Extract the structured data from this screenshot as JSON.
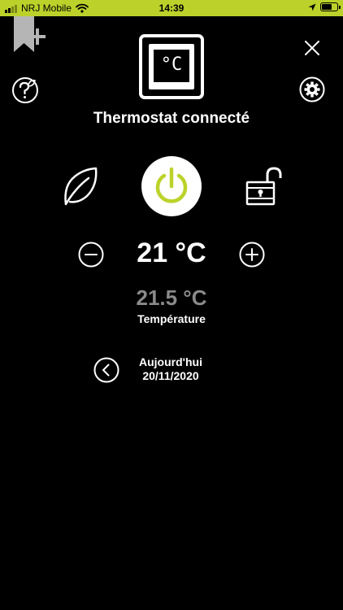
{
  "status_bar": {
    "carrier": "NRJ Mobile",
    "time": "14:39"
  },
  "device": {
    "title": "Thermostat connecté",
    "display_unit": "°C"
  },
  "setpoint": {
    "value": "21 °C"
  },
  "measured": {
    "value": "21.5 °C",
    "label": "Température"
  },
  "date": {
    "day_label": "Aujourd'hui",
    "date": "20/11/2020"
  },
  "colors": {
    "accent": "#bcd22a",
    "background": "#000000",
    "muted": "#8a8a8a"
  }
}
